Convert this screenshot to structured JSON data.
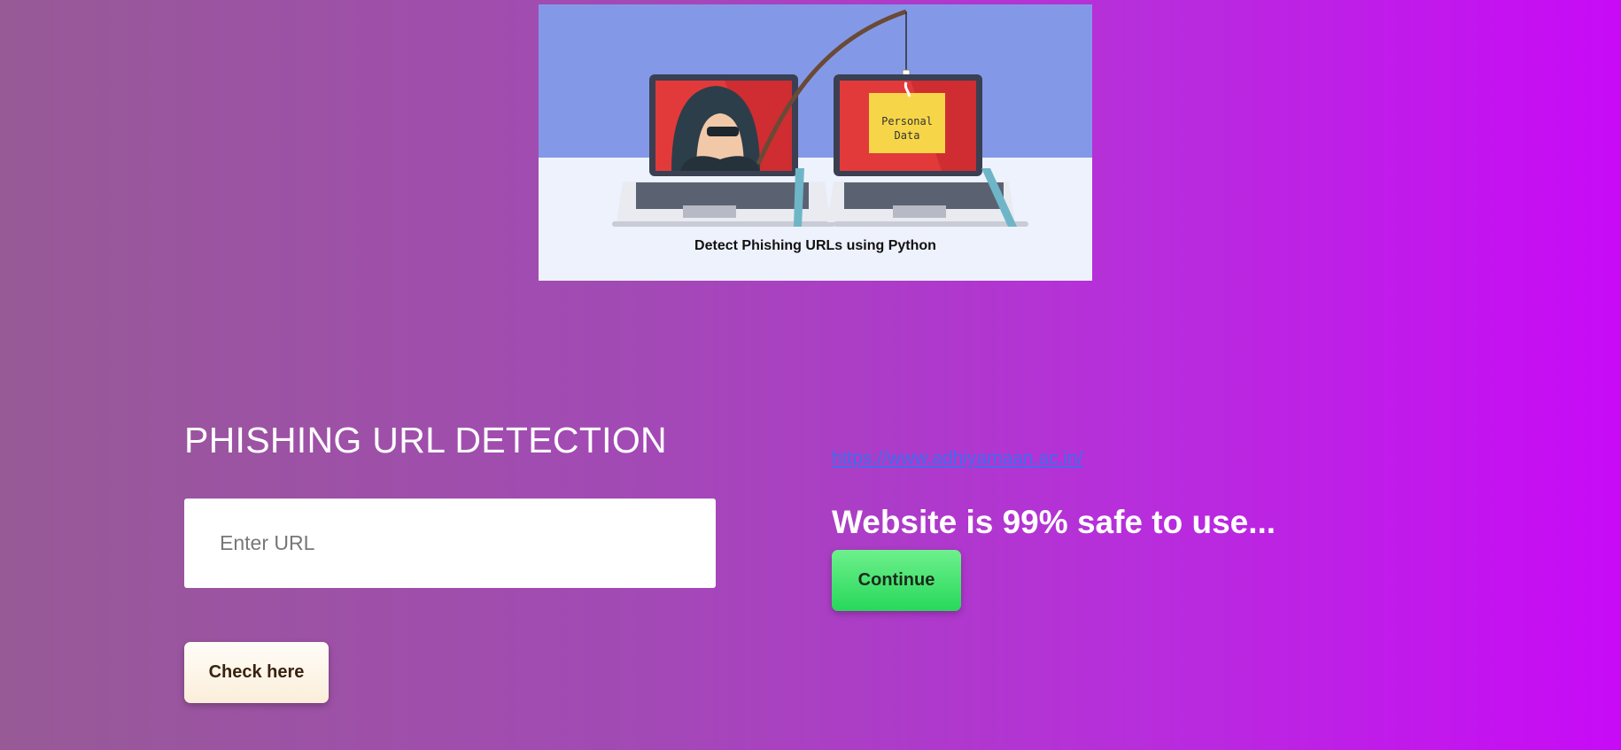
{
  "banner": {
    "caption": "Detect Phishing URLs using Python",
    "note_text_line1": "Personal",
    "note_text_line2": "Data"
  },
  "page": {
    "title": "PHISHING URL DETECTION"
  },
  "form": {
    "url_placeholder": "Enter URL",
    "url_value": "",
    "check_label": "Check here"
  },
  "result": {
    "url": "https://www.adhiyamaan.ac.in/",
    "message": "Website is 99% safe to use...",
    "continue_label": "Continue"
  }
}
